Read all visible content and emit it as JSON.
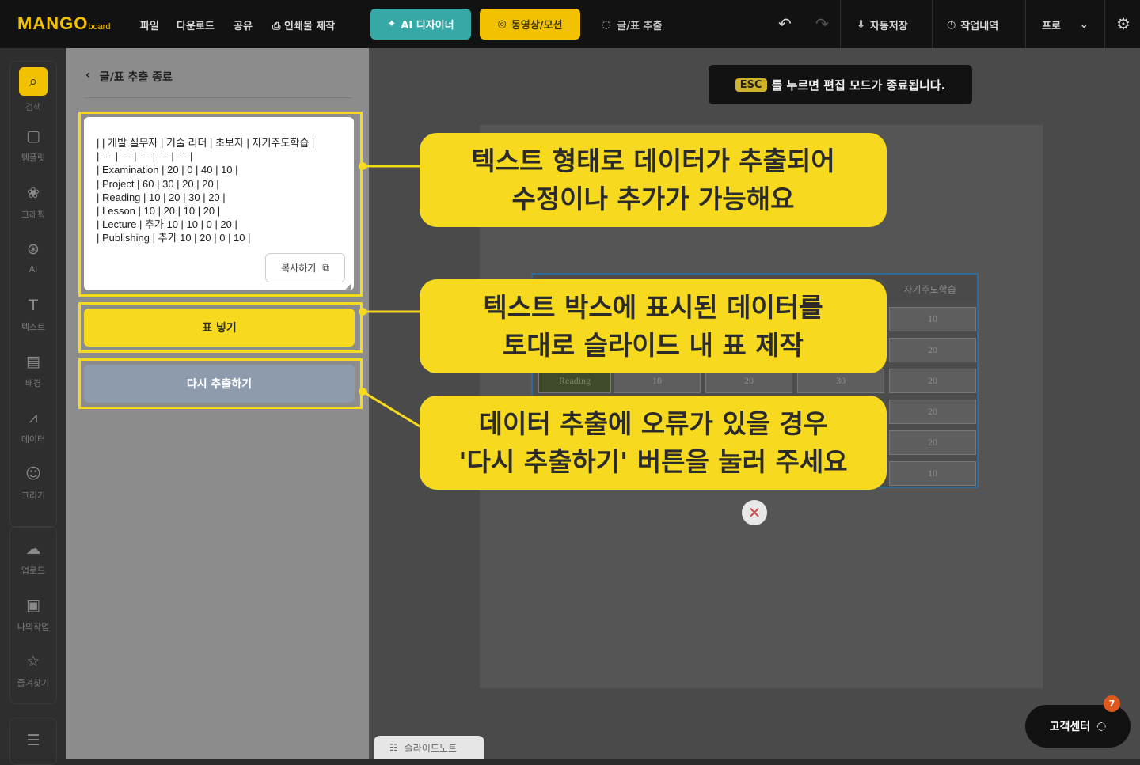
{
  "header": {
    "logo": "MANGO",
    "logo_sub": "board",
    "menu": [
      "파일",
      "다운로드",
      "공유",
      "인쇄물 제작"
    ],
    "ai_designer": "AI 디자이너",
    "video_motion": "동영상/모션",
    "text_table_extract": "글/표 추출",
    "autosave": "자동저장",
    "history": "작업내역",
    "plan": "프로"
  },
  "sidebar": {
    "items": [
      {
        "label": "검색",
        "icon": "search-icon"
      },
      {
        "label": "템플릿",
        "icon": "template-icon"
      },
      {
        "label": "그래픽",
        "icon": "graphic-icon"
      },
      {
        "label": "AI",
        "icon": "ai-icon"
      },
      {
        "label": "텍스트",
        "icon": "text-icon"
      },
      {
        "label": "배경",
        "icon": "background-icon"
      },
      {
        "label": "데이터",
        "icon": "chart-icon"
      },
      {
        "label": "그리기",
        "icon": "draw-icon"
      }
    ],
    "items2": [
      {
        "label": "업로드",
        "icon": "upload-icon"
      },
      {
        "label": "나의작업",
        "icon": "folder-icon"
      },
      {
        "label": "즐겨찾기",
        "icon": "favorite-icon"
      }
    ]
  },
  "panel": {
    "title": "글/표 추출 종료",
    "extracted_text": "| | 개발 실무자 | 기술 리더 | 초보자 | 자기주도학습 |\n| --- | --- | --- | --- | --- |\n| Examination | 20 | 0 | 40 | 10 |\n| Project | 60 | 30 | 20 | 20 |\n| Reading | 10 | 20 | 30 | 20 |\n| Lesson | 10 | 20 | 10 | 20 |\n| Lecture | 추가 10 | 10 | 0 | 20 |\n| Publishing | 추가 10 | 20 | 0 | 10 |",
    "copy_label": "복사하기",
    "insert_table_label": "표 넣기",
    "reextract_label": "다시 추출하기"
  },
  "editor": {
    "esc_key": "ESC",
    "esc_message": "를 누르면 편집 모드가 종료됩니다.",
    "slide_note": "슬라이드노트",
    "support": "고객센터",
    "support_badge": "7"
  },
  "table_preview": {
    "header_last": "자기주도학습",
    "reading_row_label": "Reading",
    "reading_row": [
      "10",
      "20",
      "30"
    ],
    "last_col": [
      "10",
      "20",
      "20",
      "20",
      "20",
      "10"
    ]
  },
  "callouts": {
    "c1": [
      "텍스트 형태로 데이터가 추출되어",
      "수정이나 추가가 가능해요"
    ],
    "c2": [
      "텍스트 박스에 표시된 데이터를",
      "토대로 슬라이드 내 표 제작"
    ],
    "c3": [
      "데이터 추출에 오류가 있을 경우",
      "'다시 추출하기' 버튼을 눌러 주세요"
    ]
  },
  "colors": {
    "accent_yellow": "#f7d91f",
    "teal": "#36a8a6",
    "button_gray": "#8e9bac"
  }
}
